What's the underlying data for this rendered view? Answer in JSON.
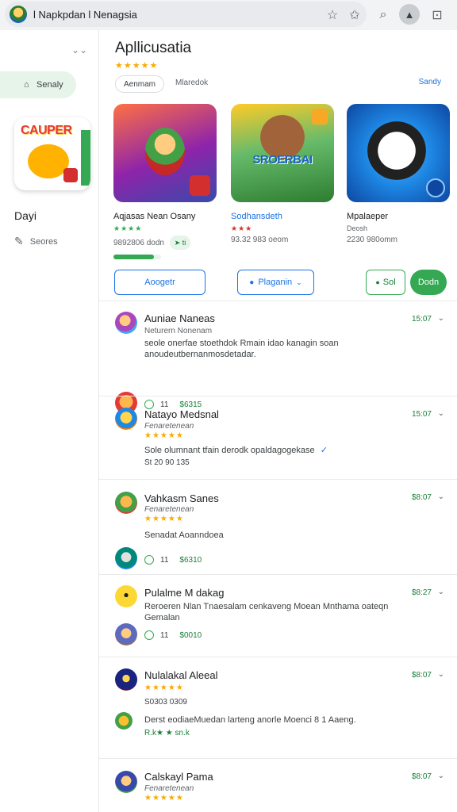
{
  "browser": {
    "url": "l Napkpdan l Nenagsia"
  },
  "sidebar": {
    "pill_label": "Senaly",
    "art_logo": "CAUPER",
    "section_title": "Dayi",
    "item_label": "Seores"
  },
  "header": {
    "title": "Apllicusatia",
    "stars": "★★★★★",
    "filter_label": "Aenmam",
    "filter_text": "Mlaredok",
    "see_link": "Sandy"
  },
  "cards": [
    {
      "name": "Aqjasas Nean  Osany",
      "stars": "★★★★",
      "meta": "9892806 dodn",
      "chip": "➤ ti",
      "progress": 0.85
    },
    {
      "name": "Sodhansdeth",
      "stars": "★★★",
      "meta": "93.32 983 oeom",
      "art_text": "SROERBAI"
    },
    {
      "name": "Mpalaeper",
      "stars": "",
      "meta": "2230 980omm",
      "sub": "Deosh"
    }
  ],
  "buttons": {
    "a": "Aoogetr",
    "b": "Plaganin",
    "c": "Sol",
    "d": "Dodn"
  },
  "reviews": [
    {
      "title": "Auniae Naneas",
      "sub": "Neturern Nonenam",
      "body": "seole onerfae stoethdok Rmain idao kanagin soan anoudeutbernanmosdetadar.",
      "time": "15:07",
      "count": "11",
      "price": "$6315",
      "stars": ""
    },
    {
      "title": "Natayo Medsnal",
      "sub": "Fenaretenean",
      "stars": "★★★★★",
      "body": "Sole olumnant tfain derodk opaldagogekase",
      "extra": "St 20 90 135",
      "time": "15:07",
      "check": "✓"
    },
    {
      "title": "Vahkasm Sanes",
      "sub": "Fenaretenean",
      "stars": "★★★★★",
      "body": "Senadat Aoanndoea",
      "time": "$8:07",
      "count": "11",
      "price": "$6310"
    },
    {
      "title": "Pulalme M dakag",
      "body": "Reroeren Nlan Tnaesalam cenkaveng Moean Mnthama oateqn Gemalan",
      "time": "$8:27",
      "count": "11",
      "price": "$0010"
    },
    {
      "title": "Nulalakal Aleeal",
      "stars": "★★★★★",
      "extra": "S0303 0309",
      "body": "Derst eodiaeMuedan larteng anorle Moenci 8 1 Aaeng.",
      "green": "R.k★ ★ sn.k",
      "time": "$8:07"
    },
    {
      "title": "Calskayl Pama",
      "sub": "Fenaretenean",
      "stars": "★★★★★",
      "time": "$8:07"
    }
  ]
}
